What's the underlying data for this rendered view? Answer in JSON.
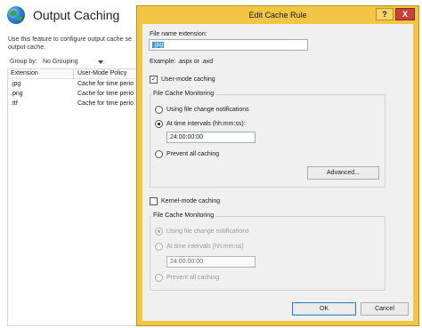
{
  "background": {
    "title": "Output Caching",
    "description_lines": [
      "Use this feature to configure output cache se",
      "output cache."
    ],
    "group_by_label": "Group by:",
    "group_by_value": "No Grouping",
    "columns": [
      "Extension",
      "User-Mode Policy"
    ],
    "rows": [
      {
        "extension": ".jpg",
        "policy": "Cache for time perio"
      },
      {
        "extension": ".png",
        "policy": "Cache for time perio"
      },
      {
        "extension": ".ttf",
        "policy": "Cache for time perio"
      }
    ]
  },
  "dialog": {
    "title": "Edit Cache Rule",
    "help_label": "?",
    "close_label": "X",
    "file_name_label": "File name extension:",
    "file_name_value": ".jpg",
    "example_text": "Example: .aspx or .axd",
    "user_mode": {
      "checkbox_label": "User-mode caching",
      "checked": true,
      "group_title": "File Cache Monitoring",
      "option_change": "Using file change notifications",
      "option_interval": "At time intervals (hh:mm:ss):",
      "interval_value": "24:00:00:00",
      "option_prevent": "Prevent all caching",
      "selected": "interval",
      "advanced_label": "Advanced..."
    },
    "kernel_mode": {
      "checkbox_label": "Kernel-mode caching",
      "checked": false,
      "group_title": "File Cache Monitoring",
      "option_change": "Using file change notifications",
      "option_interval": "At time intervals (hh:mm:ss)",
      "interval_value": "24:00:00:00",
      "option_prevent": "Prevent all caching",
      "selected": "change"
    },
    "ok_label": "OK",
    "cancel_label": "Cancel"
  }
}
